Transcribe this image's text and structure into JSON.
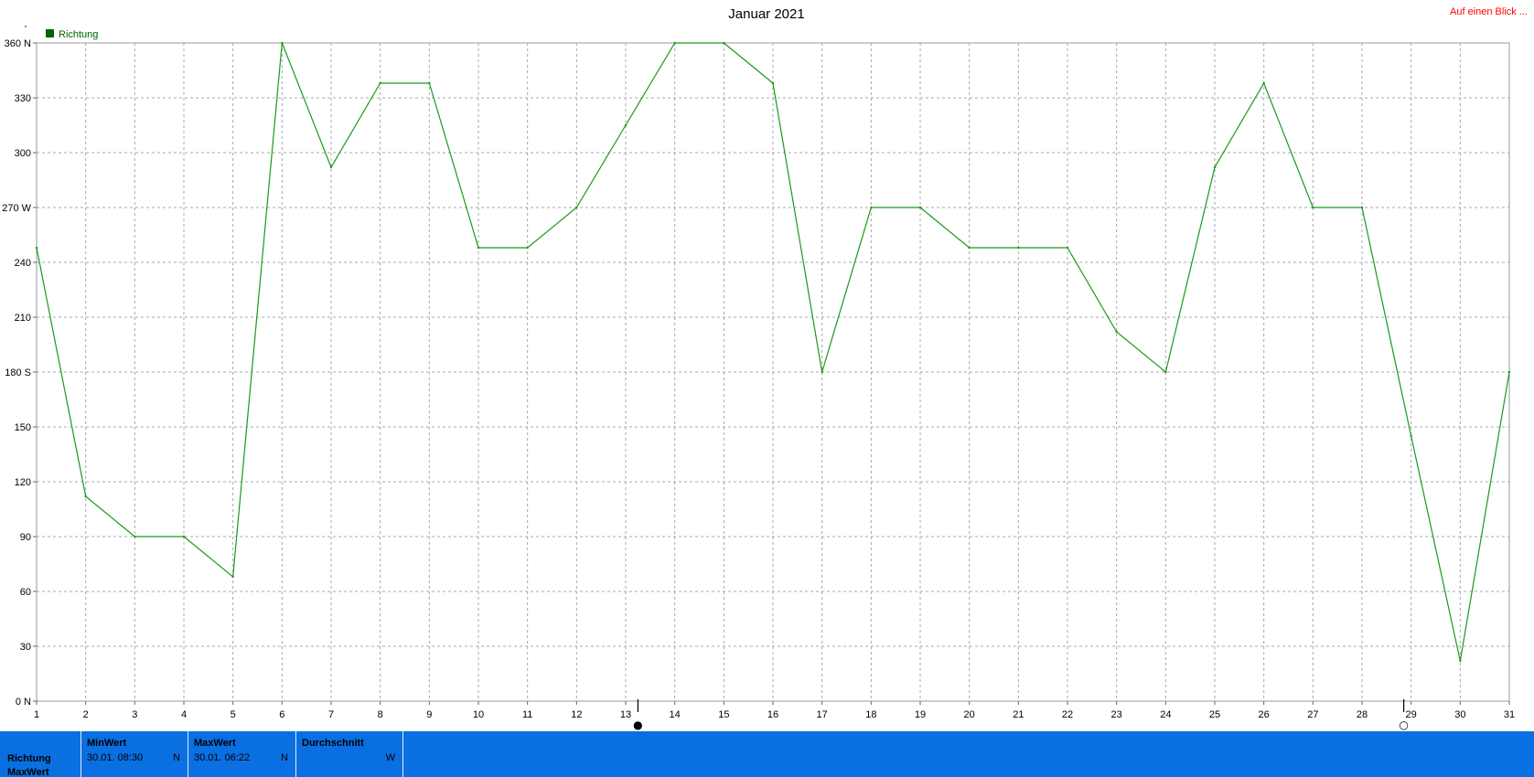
{
  "title": "Januar 2021",
  "link_label": "Auf einen Blick ...",
  "legend": {
    "label": "Richtung",
    "color": "#006400"
  },
  "chart_data": {
    "type": "line",
    "title": "Januar 2021",
    "x": [
      1,
      2,
      3,
      4,
      5,
      6,
      7,
      8,
      9,
      10,
      11,
      12,
      13,
      14,
      15,
      16,
      17,
      18,
      19,
      20,
      21,
      22,
      23,
      24,
      25,
      26,
      27,
      28,
      29,
      30,
      31
    ],
    "series": [
      {
        "name": "Richtung",
        "color": "#1a9a1a",
        "values": [
          248,
          112,
          90,
          90,
          68,
          360,
          292,
          338,
          338,
          248,
          248,
          270,
          315,
          360,
          360,
          338,
          180,
          270,
          270,
          248,
          248,
          248,
          202,
          180,
          292,
          338,
          270,
          270,
          145,
          22,
          180
        ]
      }
    ],
    "xlim": [
      1,
      31
    ],
    "ylim": [
      0,
      360
    ],
    "ytick_labels": [
      "0 N",
      "30",
      "60",
      "90",
      "120",
      "150",
      "180 S",
      "210",
      "240",
      "270 W",
      "300",
      "330",
      "360 N"
    ],
    "grid": true,
    "legend_position": "top-left",
    "moon_markers": [
      {
        "x": 13.25,
        "icon": "new-moon-icon",
        "symbol": "●"
      },
      {
        "x": 28.85,
        "icon": "full-moon-icon",
        "symbol": "○"
      }
    ]
  },
  "stats": {
    "row_labels": [
      "Richtung",
      "MaxWert"
    ],
    "columns": [
      {
        "header": "MinWert",
        "value": "30.01.  08:30",
        "unit": "N"
      },
      {
        "header": "MaxWert",
        "value": "30.01.  06:22",
        "unit": "N"
      },
      {
        "header": "Durchschnitt",
        "value": "",
        "unit": "W"
      }
    ]
  }
}
